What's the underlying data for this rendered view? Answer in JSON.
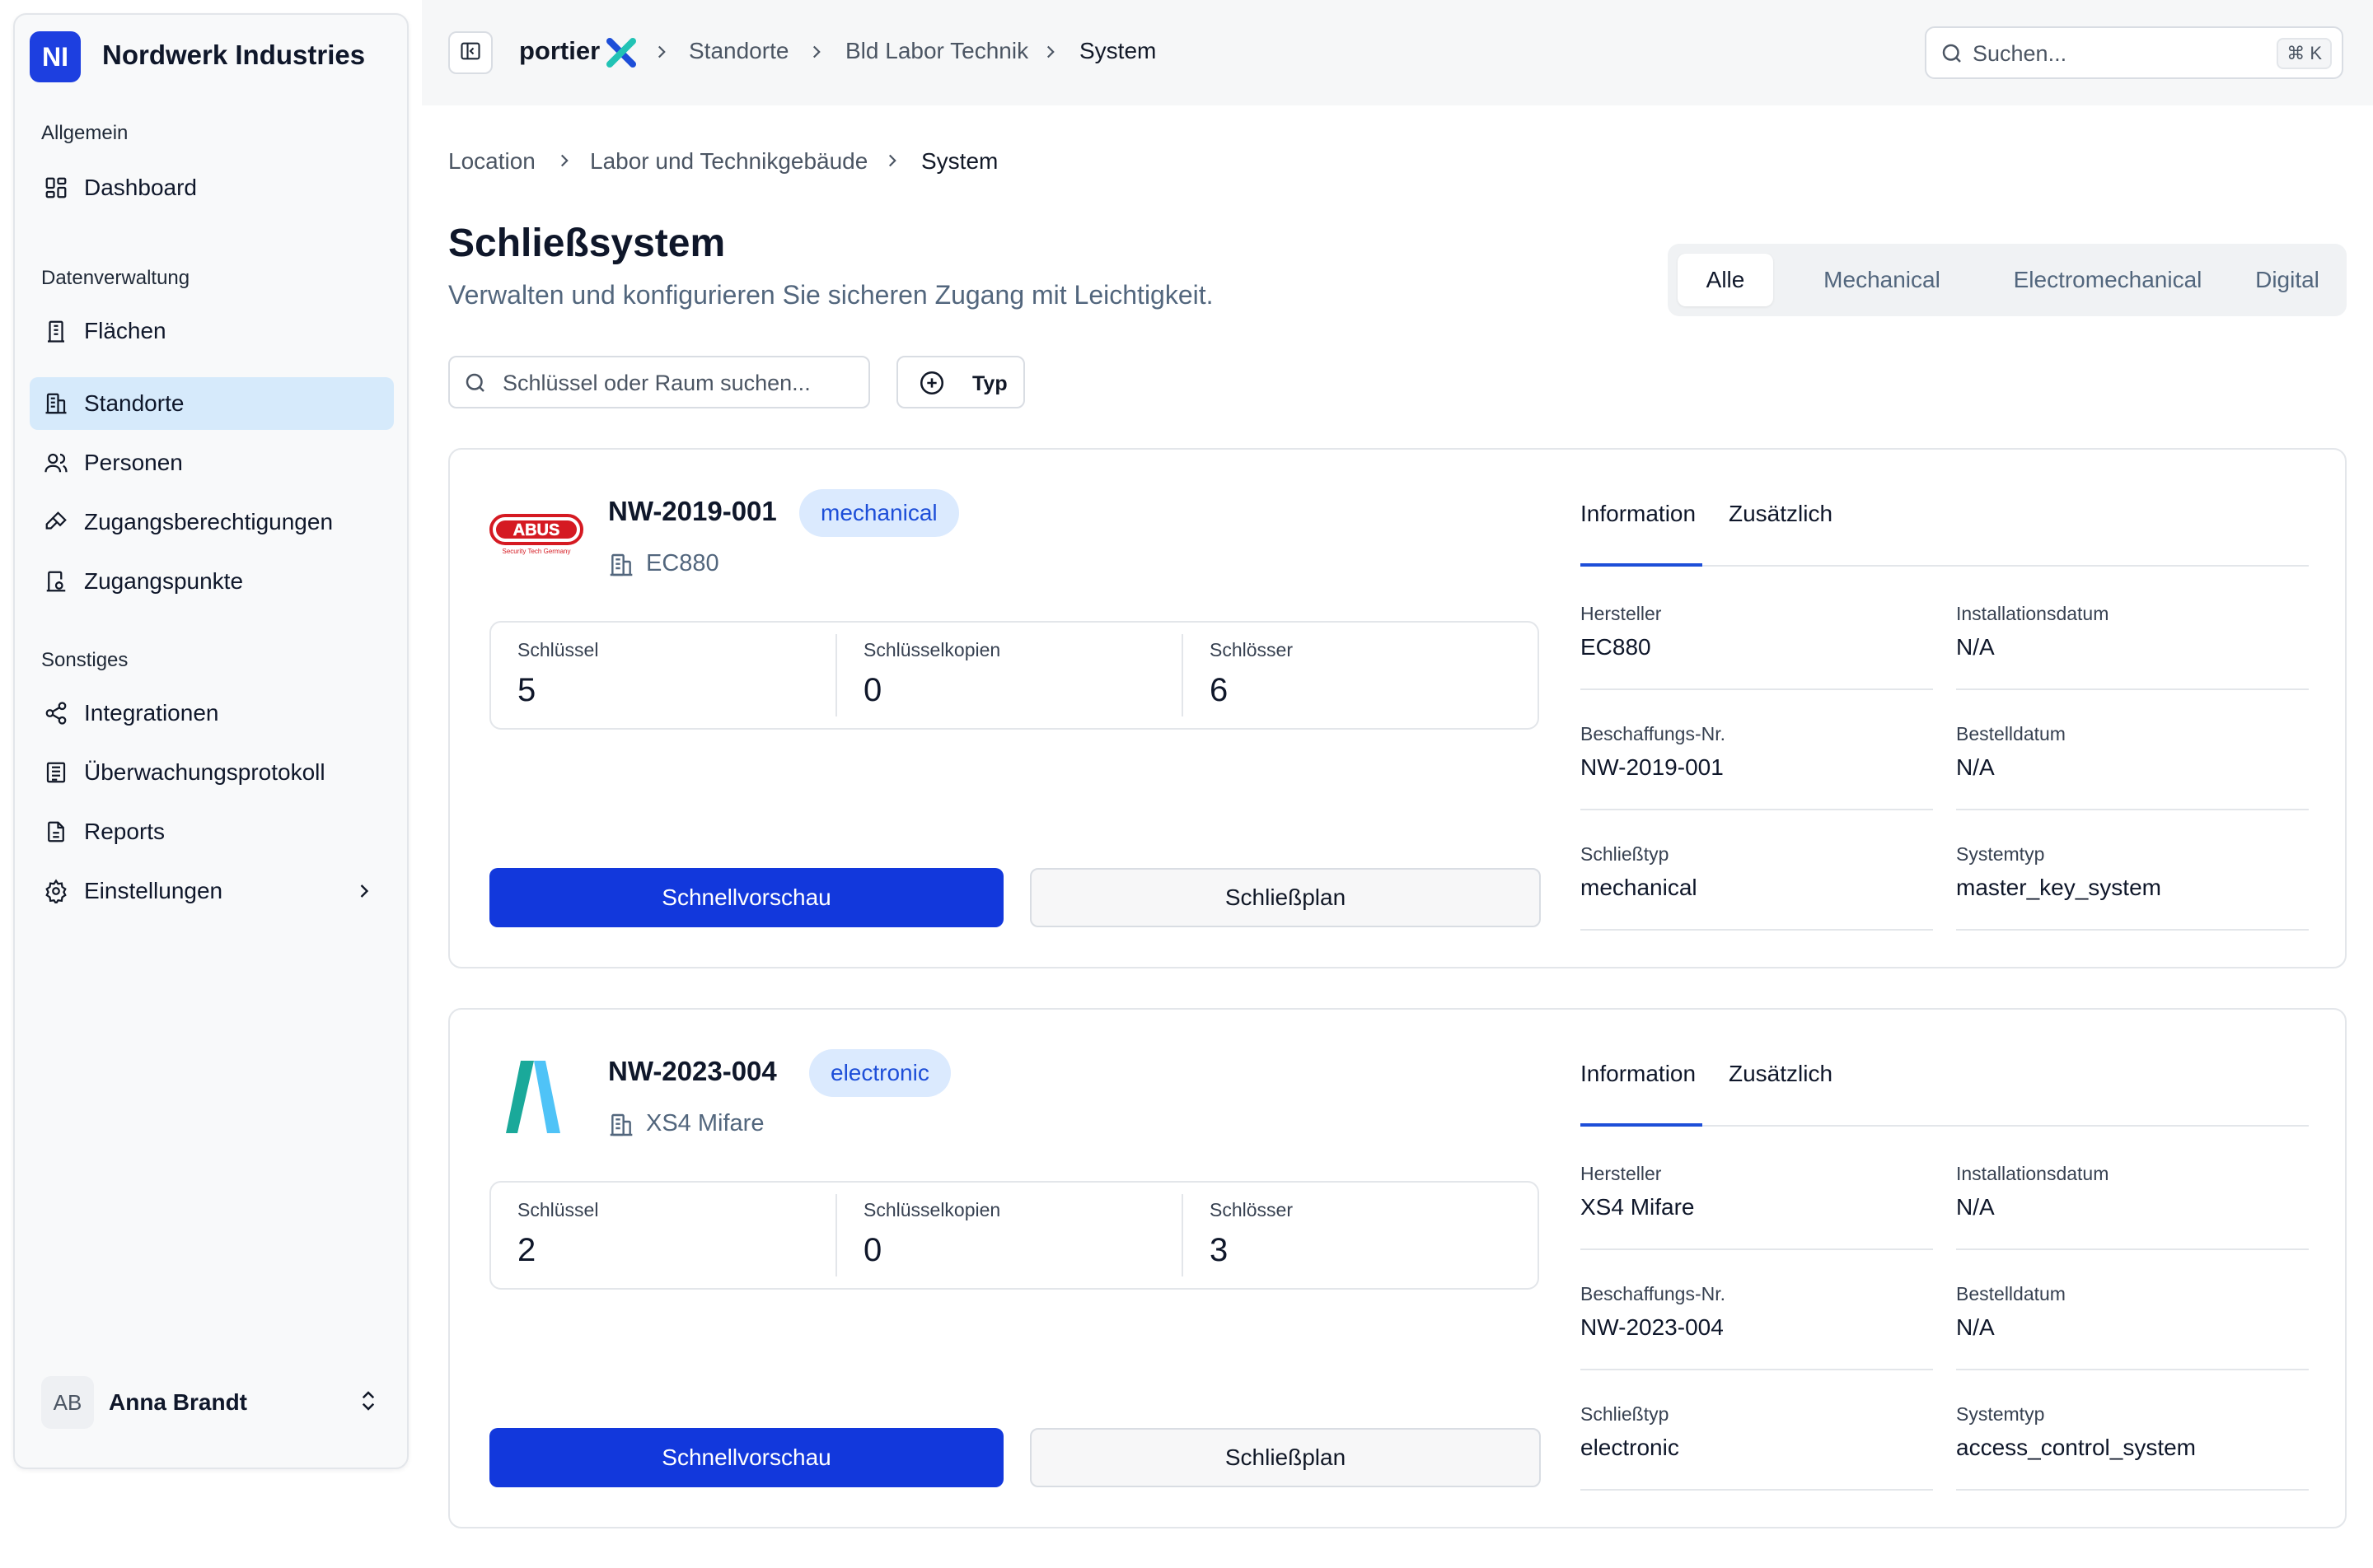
{
  "sidebar": {
    "org_initials": "NI",
    "org_name": "Nordwerk Industries",
    "sections": {
      "general": "Allgemein",
      "data": "Datenverwaltung",
      "other": "Sonstiges"
    },
    "items": [
      {
        "label": "Dashboard",
        "icon": "dashboard-icon"
      },
      {
        "label": "Flächen",
        "icon": "building-icon"
      },
      {
        "label": "Standorte",
        "icon": "office-building-icon",
        "active": true
      },
      {
        "label": "Personen",
        "icon": "users-icon"
      },
      {
        "label": "Zugangsberechtigungen",
        "icon": "key-icon"
      },
      {
        "label": "Zugangspunkte",
        "icon": "door-icon"
      },
      {
        "label": "Integrationen",
        "icon": "share-icon"
      },
      {
        "label": "Überwachungsprotokoll",
        "icon": "log-icon"
      },
      {
        "label": "Reports",
        "icon": "report-icon"
      },
      {
        "label": "Einstellungen",
        "icon": "gear-icon"
      }
    ],
    "user": {
      "initials": "AB",
      "name": "Anna Brandt"
    }
  },
  "topbar": {
    "brand": "portier",
    "breadcrumb": [
      "Standorte",
      "Bld Labor Technik",
      "System"
    ],
    "search_placeholder": "Suchen...",
    "shortcut": "⌘ K"
  },
  "page": {
    "breadcrumb": [
      "Location",
      "Labor und Technikgebäude",
      "System"
    ],
    "title": "Schließsystem",
    "subtitle": "Verwalten und konfigurieren Sie sicheren Zugang mit Leichtigkeit.",
    "segments": [
      "Alle",
      "Mechanical",
      "Electromechanical",
      "Digital"
    ],
    "active_segment": "Alle",
    "filter_placeholder": "Schlüssel oder Raum suchen...",
    "type_button": "Typ"
  },
  "card_labels": {
    "keys": "Schlüssel",
    "key_copies": "Schlüsselkopien",
    "locks": "Schlösser",
    "preview_button": "Schnellvorschau",
    "plan_button": "Schließplan",
    "tab_info": "Information",
    "tab_extra": "Zusätzlich",
    "manufacturer": "Hersteller",
    "install_date": "Installationsdatum",
    "procurement_no": "Beschaffungs-Nr.",
    "order_date": "Bestelldatum",
    "lock_type": "Schließtyp",
    "system_type": "Systemtyp"
  },
  "systems": [
    {
      "id": "NW-2019-001",
      "badge": "mechanical",
      "logo_text": "ABUS",
      "logo_tagline": "Security Tech Germany",
      "model": "EC880",
      "keys": "5",
      "key_copies": "0",
      "locks": "6",
      "manufacturer": "EC880",
      "install_date": "N/A",
      "procurement_no": "NW-2019-001",
      "order_date": "N/A",
      "lock_type": "mechanical",
      "system_type": "master_key_system"
    },
    {
      "id": "NW-2023-004",
      "badge": "electronic",
      "model": "XS4 Mifare",
      "keys": "2",
      "key_copies": "0",
      "locks": "3",
      "manufacturer": "XS4 Mifare",
      "install_date": "N/A",
      "procurement_no": "NW-2023-004",
      "order_date": "N/A",
      "lock_type": "electronic",
      "system_type": "access_control_system"
    }
  ],
  "colors": {
    "primary": "#1238dc",
    "active_nav": "#d6eafb",
    "badge_bg": "#dbeafe",
    "badge_text": "#1d4ed8"
  }
}
